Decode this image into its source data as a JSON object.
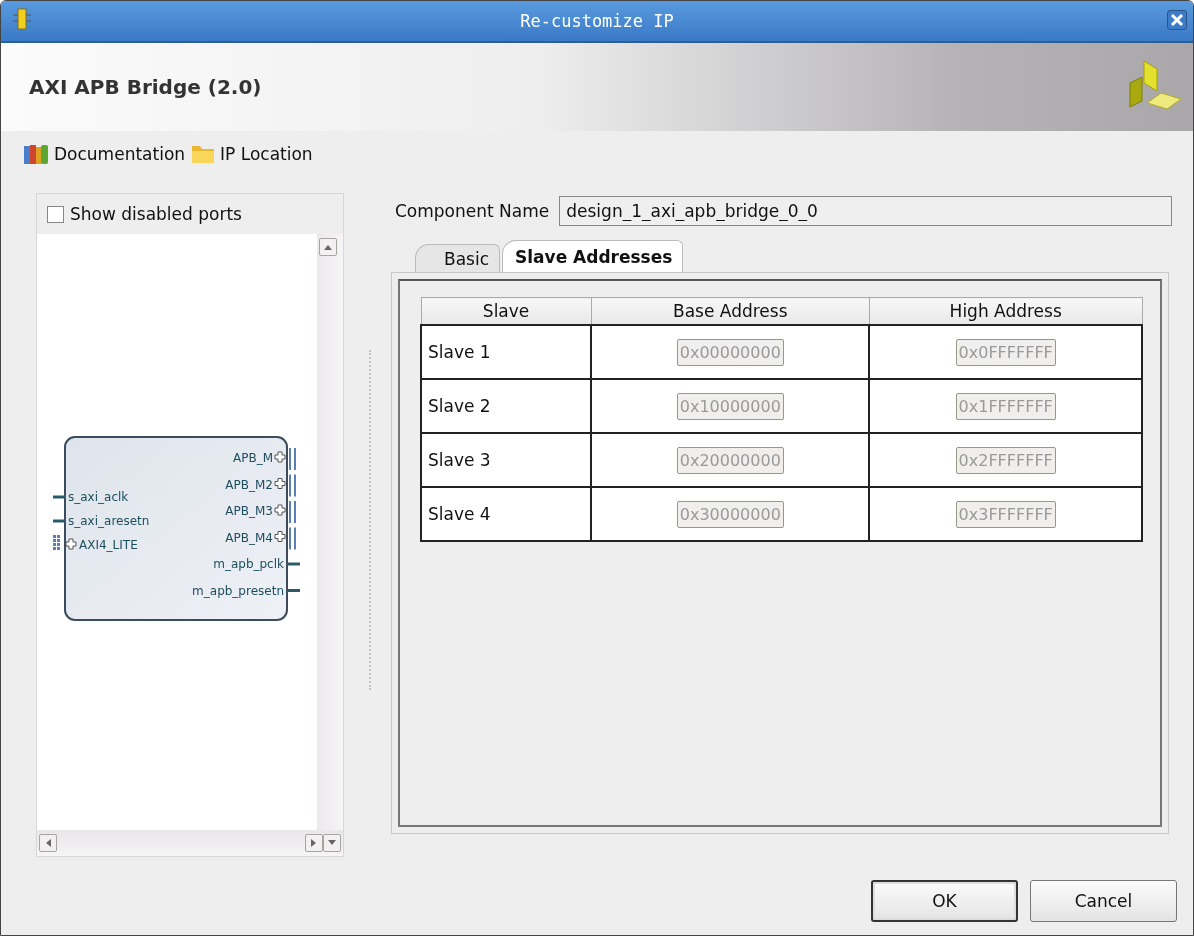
{
  "window": {
    "title": "Re-customize IP"
  },
  "header": {
    "title": "AXI APB Bridge (2.0)"
  },
  "links": [
    {
      "kind": "books",
      "label": "Documentation"
    },
    {
      "kind": "folder",
      "label": "IP Location"
    }
  ],
  "symbol_panel": {
    "show_disabled": {
      "label": "Show disabled ports",
      "checked": false
    },
    "block": {
      "left_ports": [
        {
          "kind": "wire",
          "label": "s_axi_aclk"
        },
        {
          "kind": "wire",
          "label": "s_axi_aresetn"
        },
        {
          "kind": "bus",
          "label": "AXI4_LITE"
        }
      ],
      "right_ports": [
        {
          "kind": "bus",
          "label": "APB_M"
        },
        {
          "kind": "bus",
          "label": "APB_M2"
        },
        {
          "kind": "bus",
          "label": "APB_M3"
        },
        {
          "kind": "bus",
          "label": "APB_M4"
        },
        {
          "kind": "wire",
          "label": "m_apb_pclk"
        },
        {
          "kind": "wire",
          "label": "m_apb_presetn"
        }
      ]
    }
  },
  "component_name": {
    "label": "Component Name",
    "value": "design_1_axi_apb_bridge_0_0"
  },
  "tabs": [
    {
      "label": "Basic",
      "selected": false
    },
    {
      "label": "Slave Addresses",
      "selected": true
    }
  ],
  "table": {
    "columns": [
      "Slave",
      "Base Address",
      "High Address"
    ],
    "rows": [
      {
        "slave": "Slave 1",
        "base": "0x00000000",
        "high": "0x0FFFFFFF",
        "disabled": true
      },
      {
        "slave": "Slave 2",
        "base": "0x10000000",
        "high": "0x1FFFFFFF",
        "disabled": true
      },
      {
        "slave": "Slave 3",
        "base": "0x20000000",
        "high": "0x2FFFFFFF",
        "disabled": true
      },
      {
        "slave": "Slave 4",
        "base": "0x30000000",
        "high": "0x3FFFFFFF",
        "disabled": true
      }
    ]
  },
  "buttons": [
    {
      "label": "OK",
      "selected": true
    },
    {
      "label": "Cancel",
      "selected": false
    }
  ]
}
